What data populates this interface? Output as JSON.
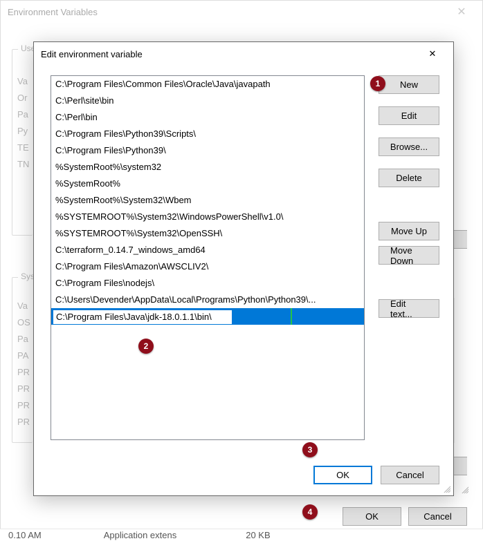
{
  "parent_dialog": {
    "title": "Environment Variables",
    "user_group_label": "User",
    "sys_group_label": "Syste",
    "user_peek": [
      "Va",
      "Or",
      "Pa",
      "Py",
      "TE",
      "TN"
    ],
    "sys_peek": [
      "Va",
      "OS",
      "Pa",
      "PA",
      "PR",
      "PR",
      "PR",
      "PR"
    ],
    "ok_label": "OK",
    "cancel_label": "Cancel"
  },
  "edit_dialog": {
    "title": "Edit environment variable",
    "path_items": [
      "C:\\Program Files\\Common Files\\Oracle\\Java\\javapath",
      "C:\\Perl\\site\\bin",
      "C:\\Perl\\bin",
      "C:\\Program Files\\Python39\\Scripts\\",
      "C:\\Program Files\\Python39\\",
      "%SystemRoot%\\system32",
      "%SystemRoot%",
      "%SystemRoot%\\System32\\Wbem",
      "%SYSTEMROOT%\\System32\\WindowsPowerShell\\v1.0\\",
      "%SYSTEMROOT%\\System32\\OpenSSH\\",
      "C:\\terraform_0.14.7_windows_amd64",
      "C:\\Program Files\\Amazon\\AWSCLIV2\\",
      "C:\\Program Files\\nodejs\\",
      "C:\\Users\\Devender\\AppData\\Local\\Programs\\Python\\Python39\\..."
    ],
    "editing_value": "C:\\Program Files\\Java\\jdk-18.0.1.1\\bin\\",
    "buttons": {
      "new": "New",
      "edit": "Edit",
      "browse": "Browse...",
      "delete": "Delete",
      "move_up": "Move Up",
      "move_down": "Move Down",
      "edit_text": "Edit text..."
    },
    "ok_label": "OK",
    "cancel_label": "Cancel"
  },
  "badges": {
    "b1": "1",
    "b2": "2",
    "b3": "3",
    "b4": "4"
  },
  "status": {
    "time": "0.10 AM",
    "col2": "Application extens",
    "col3": "20 KB"
  }
}
